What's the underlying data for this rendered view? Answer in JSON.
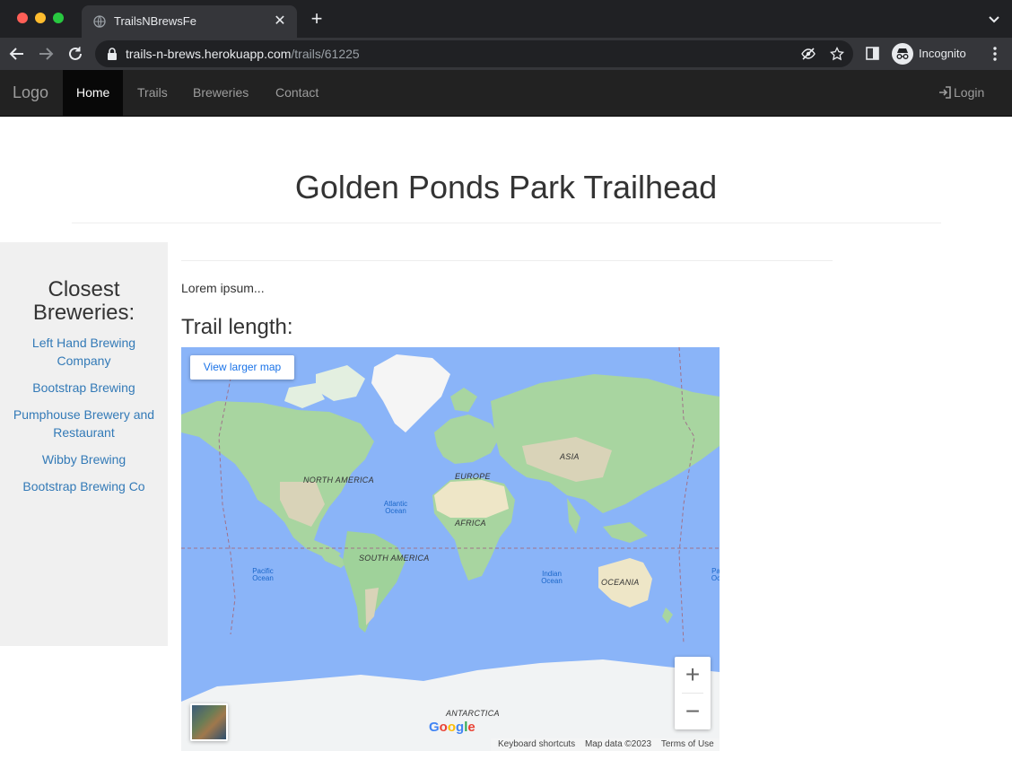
{
  "browser": {
    "tab_title": "TrailsNBrewsFe",
    "url_host": "trails-n-brews.herokuapp.com",
    "url_path": "/trails/61225",
    "profile_label": "Incognito"
  },
  "navbar": {
    "brand": "Logo",
    "links": [
      {
        "label": "Home",
        "active": true
      },
      {
        "label": "Trails"
      },
      {
        "label": "Breweries"
      },
      {
        "label": "Contact"
      }
    ],
    "login": "Login"
  },
  "page": {
    "title": "Golden Ponds Park Trailhead",
    "description": "Lorem ipsum...",
    "trail_length_label": "Trail length:"
  },
  "sidebar": {
    "heading": "Closest Breweries:",
    "breweries": [
      "Left Hand Brewing Company",
      "Bootstrap Brewing",
      "Pumphouse Brewery and Restaurant",
      "Wibby Brewing",
      "Bootstrap Brewing Co"
    ]
  },
  "map": {
    "larger_map_label": "View larger map",
    "continents": [
      "NORTH AMERICA",
      "SOUTH AMERICA",
      "EUROPE",
      "AFRICA",
      "ASIA",
      "OCEANIA",
      "ANTARCTICA"
    ],
    "oceans": [
      "Atlantic Ocean",
      "Pacific Ocean",
      "Indian Ocean",
      "Pa Oc"
    ],
    "zoom_in": "+",
    "zoom_out": "−",
    "logo": "Google",
    "attribution": {
      "shortcuts": "Keyboard shortcuts",
      "data": "Map data ©2023",
      "terms": "Terms of Use"
    }
  },
  "colors": {
    "navbar_bg": "#222222",
    "link": "#337ab7",
    "water": "#8ab4f8",
    "land": "#a8d5a0"
  }
}
